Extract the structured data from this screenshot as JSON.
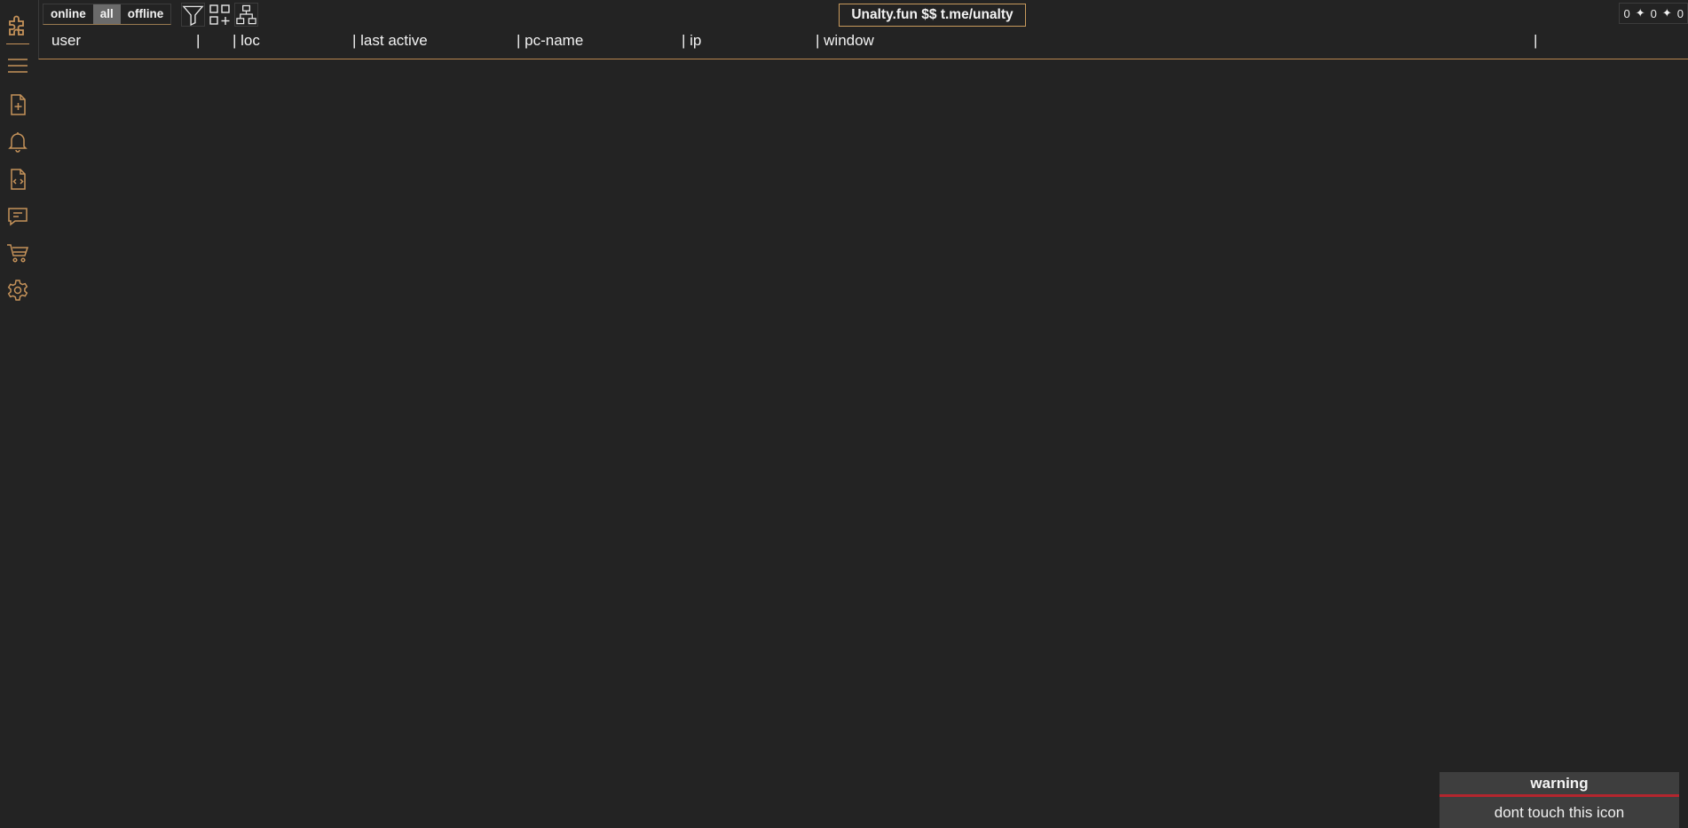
{
  "colors": {
    "background": "#232323",
    "accent": "#c6935a",
    "warning_bar": "#b3262e"
  },
  "sidebar": {
    "items": [
      {
        "icon": "puzzle-icon"
      },
      {
        "icon": "menu-icon"
      },
      {
        "icon": "file-add-icon"
      },
      {
        "icon": "bell-icon"
      },
      {
        "icon": "file-code-icon"
      },
      {
        "icon": "message-icon"
      },
      {
        "icon": "cart-icon"
      },
      {
        "icon": "gear-icon"
      }
    ]
  },
  "toolbar": {
    "filters": [
      "online",
      "all",
      "offline"
    ],
    "active_filter": "all",
    "tools": [
      {
        "icon": "filter-icon"
      },
      {
        "icon": "grid-add-icon"
      },
      {
        "icon": "network-icon"
      }
    ],
    "brand": "Unalty.fun $$ t.me/unalty",
    "counters": [
      "0",
      "0",
      "0"
    ],
    "counter_separator": "✦"
  },
  "table": {
    "columns": [
      "user",
      "",
      "| loc",
      "| last active",
      "| pc-name",
      "| ip",
      "| window",
      ""
    ]
  },
  "toast": {
    "title": "warning",
    "message": "dont touch this icon"
  }
}
